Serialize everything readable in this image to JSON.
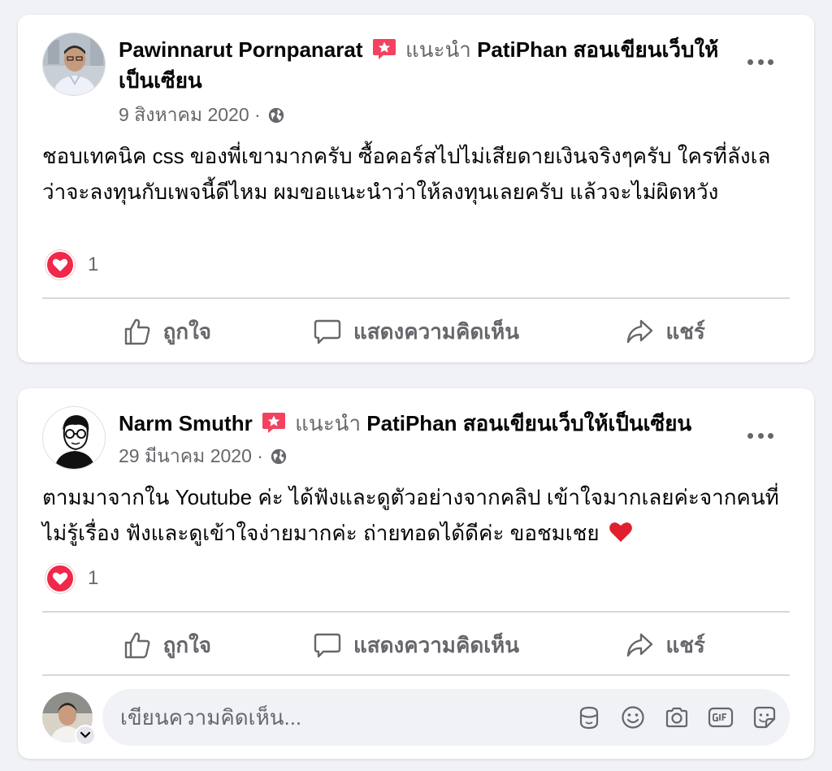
{
  "posts": [
    {
      "author": "Pawinnarut Pornpanarat",
      "recommends_label": "แนะนำ",
      "page_name": "PatiPhan สอนเขียนเว็บให้เป็นเซียน",
      "date": "9 สิงหาคม 2020 ·",
      "text": "ชอบเทคนิค css ของพี่เขามากครับ ซื้อคอร์สไปไม่เสียดายเงินจริงๆครับ ใครที่ลังเลว่าจะลงทุนกับเพจนี้ดีไหม ผมขอแนะนำว่าให้ลงทุนเลยครับ แล้วจะไม่ผิดหวัง",
      "reaction_count": "1"
    },
    {
      "author": "Narm Smuthr",
      "recommends_label": "แนะนำ",
      "page_name": "PatiPhan สอนเขียนเว็บให้เป็นเซียน",
      "date": "29 มีนาคม 2020 ·",
      "text": "ตามมาจากใน Youtube ค่ะ ได้ฟังและดูตัวอย่างจากคลิป เข้าใจมากเลยค่ะจากคนที่ไม่รู้เรื่อง ฟังและดูเข้าใจง่ายมากค่ะ ถ่ายทอดได้ดีค่ะ ขอชมเชย",
      "reaction_count": "1"
    }
  ],
  "actions": {
    "like": "ถูกใจ",
    "comment": "แสดงความคิดเห็น",
    "share": "แชร์"
  },
  "comment_box": {
    "placeholder": "เขียนความคิดเห็น..."
  },
  "icons": {
    "badge": "recommend-star-icon",
    "privacy": "globe-icon",
    "reaction": "love-reaction-icon",
    "more": "more-options-icon"
  },
  "colors": {
    "love": "#f0284a",
    "badge": "#f3425f",
    "secondary_text": "#65676b"
  }
}
